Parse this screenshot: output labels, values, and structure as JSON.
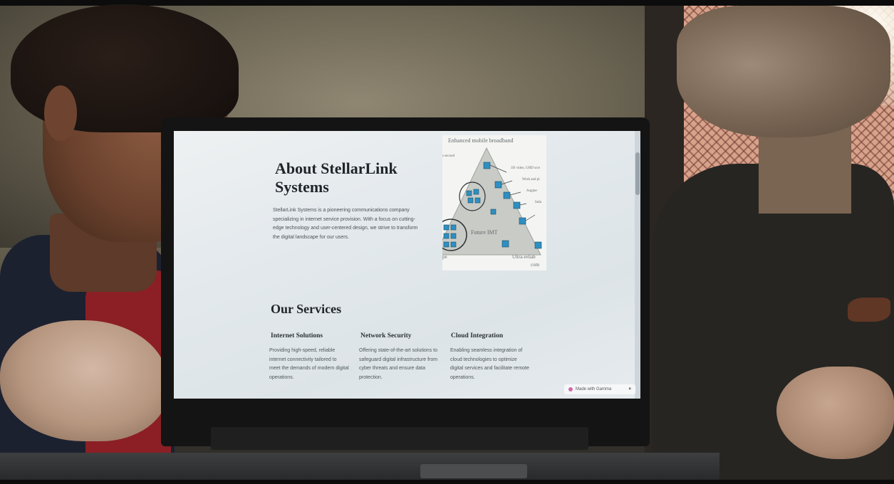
{
  "website": {
    "about": {
      "title": "About StellarLink Systems",
      "body": "StellarLink Systems is a pioneering communications company specializing in internet service provision. With a focus on cutting-edge technology and user-centered design, we strive to transform the digital landscape for our users."
    },
    "figure": {
      "top_caption": "Enhanced mobile broadband",
      "left_caption": "s second",
      "right_captions": [
        "3D video, UHD scre",
        "Work and pl",
        "Augme",
        "Indu"
      ],
      "center_caption": "Future IMT",
      "bottom_left": "pe",
      "bottom_right_1": "Ultra-reliab",
      "bottom_right_2": "com"
    },
    "services": {
      "title": "Our Services",
      "items": [
        {
          "title": "Internet Solutions",
          "body": "Providing high-speed, reliable internet connectivity tailored to meet the demands of modern digital operations."
        },
        {
          "title": "Network Security",
          "body": "Offering state-of-the-art solutions to safeguard digital infrastructure from cyber threats and ensure data protection."
        },
        {
          "title": "Cloud Integration",
          "body": "Enabling seamless integration of cloud technologies to optimize digital services and facilitate remote operations."
        }
      ]
    },
    "badge": {
      "label": "Made with Gamma",
      "close": "×"
    }
  },
  "colors": {
    "accent_icon": "#2f8fc1",
    "triangle": "#c9cbc6",
    "screen_bg": "#e6ebee"
  }
}
